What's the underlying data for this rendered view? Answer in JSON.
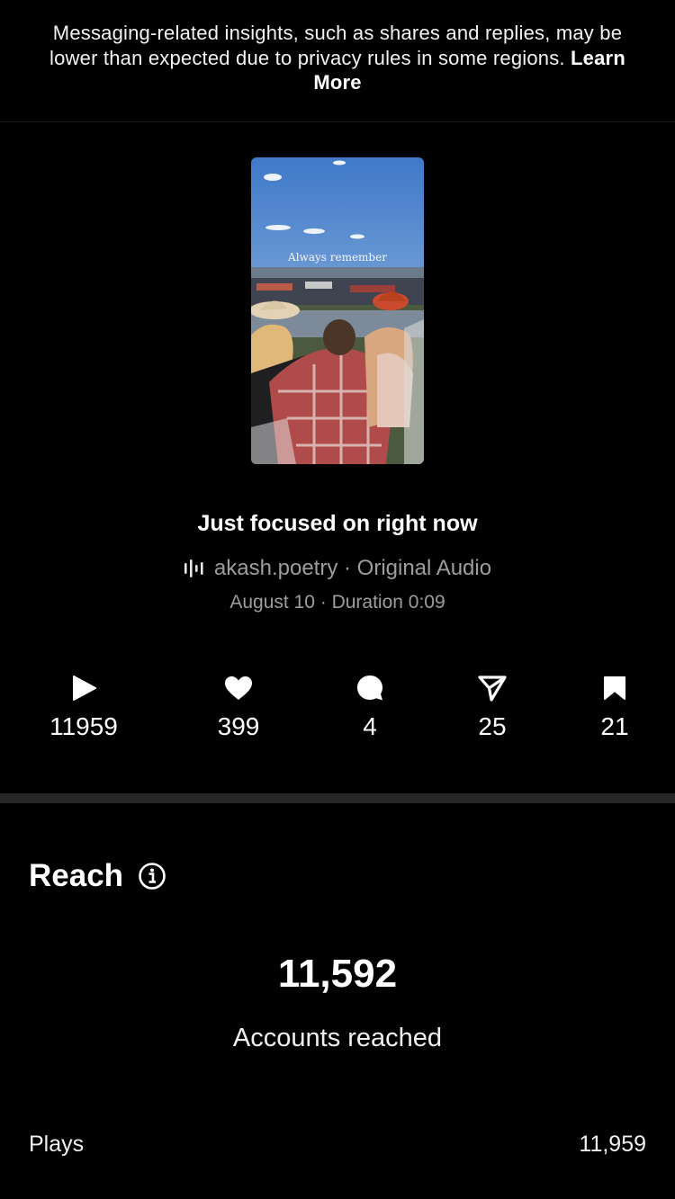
{
  "notice": {
    "text": "Messaging-related insights, such as shares and replies, may be lower than expected due to privacy rules in some regions.",
    "link": "Learn More"
  },
  "thumbnail": {
    "caption": "Always remember"
  },
  "post": {
    "title": "Just focused on right now",
    "audio_user": "akash.poetry",
    "audio_name": "Original Audio",
    "date": "August 10",
    "duration": "Duration 0:09"
  },
  "stats": {
    "plays": "11959",
    "likes": "399",
    "comments": "4",
    "shares": "25",
    "saves": "21"
  },
  "reach": {
    "heading": "Reach",
    "accounts_value": "11,592",
    "accounts_label": "Accounts reached",
    "rows": [
      {
        "label": "Plays",
        "value": "11,959"
      }
    ]
  }
}
